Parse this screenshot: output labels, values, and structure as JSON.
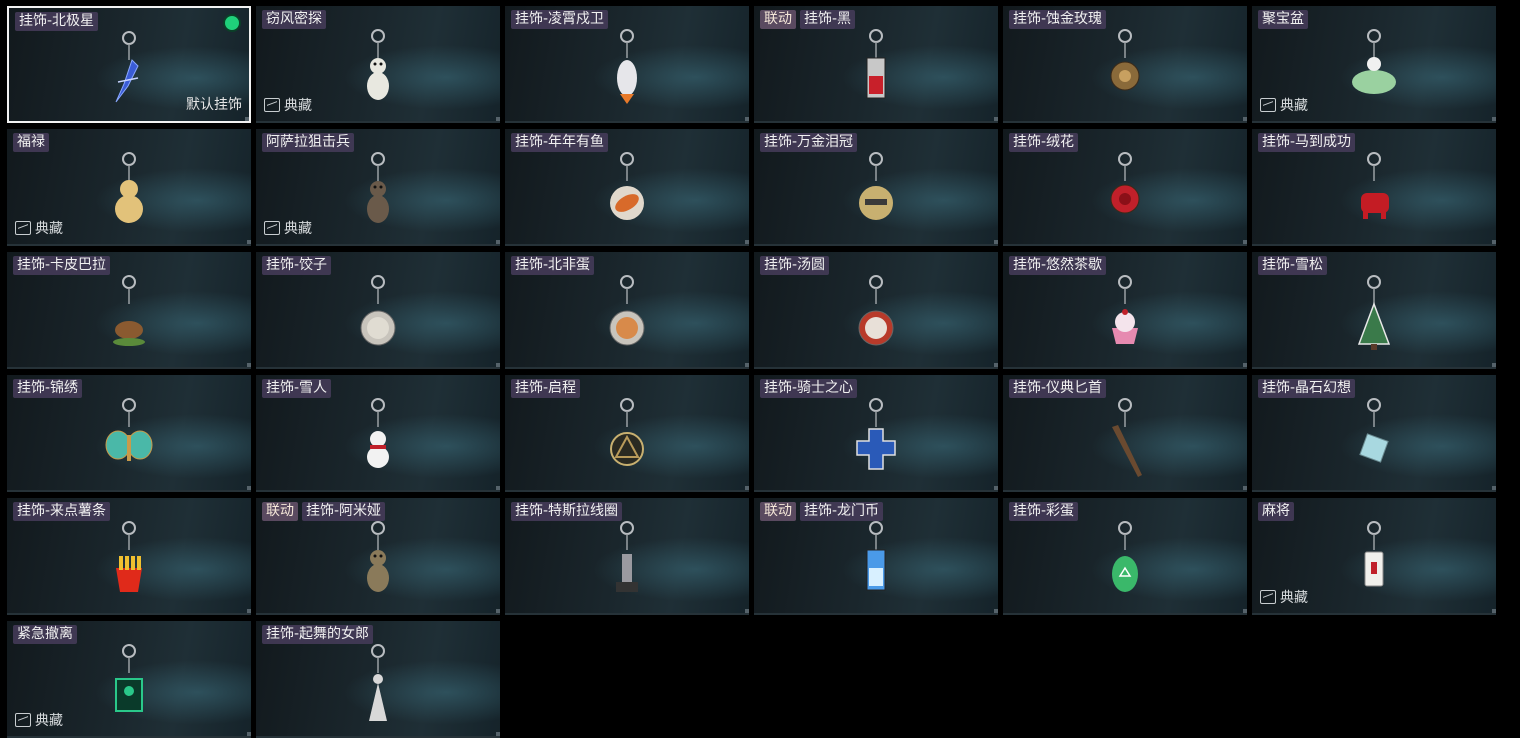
{
  "default_label": "默认挂饰",
  "collection_label": "典藏",
  "items": [
    {
      "labels": [
        "挂饰-北极星"
      ],
      "selected": true,
      "default": true,
      "shape": "star",
      "color": "#3a5cd6"
    },
    {
      "labels": [
        "窃风密探"
      ],
      "collection": true,
      "shape": "figure",
      "color": "#e8e8e0"
    },
    {
      "labels": [
        "挂饰-凌霄戍卫"
      ],
      "shape": "rocket",
      "color": "#e6e6ea"
    },
    {
      "labels": [
        "联动",
        "挂饰-黑"
      ],
      "collab": true,
      "shape": "tag",
      "color": "#c8c8c8"
    },
    {
      "labels": [
        "挂饰-蚀金玫瑰"
      ],
      "shape": "rose-gold",
      "color": "#8a6a3a"
    },
    {
      "labels": [
        "聚宝盆"
      ],
      "collection": true,
      "shape": "bowl",
      "color": "#9ad1a0"
    },
    {
      "labels": [
        "福禄"
      ],
      "collection": true,
      "shape": "gourd",
      "color": "#e2c27a"
    },
    {
      "labels": [
        "阿萨拉狙击兵"
      ],
      "collection": true,
      "shape": "figure",
      "color": "#6a5a4a"
    },
    {
      "labels": [
        "挂饰-年年有鱼"
      ],
      "shape": "fish",
      "color": "#d86a2a"
    },
    {
      "labels": [
        "挂饰-万金泪冠"
      ],
      "shape": "coin",
      "color": "#c8b070"
    },
    {
      "labels": [
        "挂饰-绒花"
      ],
      "shape": "rose",
      "color": "#c0202a"
    },
    {
      "labels": [
        "挂饰-马到成功"
      ],
      "shape": "horse",
      "color": "#c41c24"
    },
    {
      "labels": [
        "挂饰-卡皮巴拉"
      ],
      "shape": "capybara",
      "color": "#8a5a30"
    },
    {
      "labels": [
        "挂饰-饺子"
      ],
      "shape": "plate",
      "color": "#e0dcd2"
    },
    {
      "labels": [
        "挂饰-北非蛋"
      ],
      "shape": "plate",
      "color": "#d88a4a"
    },
    {
      "labels": [
        "挂饰-汤圆"
      ],
      "shape": "bowl-red",
      "color": "#b83a2a"
    },
    {
      "labels": [
        "挂饰-悠然茶歇"
      ],
      "shape": "cake",
      "color": "#e68ab0"
    },
    {
      "labels": [
        "挂饰-雪松"
      ],
      "shape": "tree",
      "color": "#3a7a4a"
    },
    {
      "labels": [
        "挂饰-锦绣"
      ],
      "shape": "butterfly",
      "color": "#4ab8a8"
    },
    {
      "labels": [
        "挂饰-雪人"
      ],
      "shape": "snowman",
      "color": "#f2f2f2"
    },
    {
      "labels": [
        "挂饰-启程"
      ],
      "shape": "medal",
      "color": "#b89a5a"
    },
    {
      "labels": [
        "挂饰-骑士之心"
      ],
      "shape": "cross",
      "color": "#2a5ab8"
    },
    {
      "labels": [
        "挂饰-仪典匕首"
      ],
      "shape": "dagger",
      "color": "#6a4a30"
    },
    {
      "labels": [
        "挂饰-晶石幻想"
      ],
      "shape": "cube",
      "color": "#a8d8e0"
    },
    {
      "labels": [
        "挂饰-来点薯条"
      ],
      "shape": "fries",
      "color": "#e02a1a"
    },
    {
      "labels": [
        "联动",
        "挂饰-阿米娅"
      ],
      "collab": true,
      "shape": "figure",
      "color": "#8a7a5a"
    },
    {
      "labels": [
        "挂饰-特斯拉线圈"
      ],
      "shape": "tower",
      "color": "#9a9aa0"
    },
    {
      "labels": [
        "联动",
        "挂饰-龙门币"
      ],
      "collab": true,
      "shape": "card",
      "color": "#4a9ae8"
    },
    {
      "labels": [
        "挂饰-彩蛋"
      ],
      "shape": "egg",
      "color": "#3ab86a"
    },
    {
      "labels": [
        "麻将"
      ],
      "collection": true,
      "shape": "mahjong",
      "color": "#f0f0ec"
    },
    {
      "labels": [
        "紧急撤离"
      ],
      "collection": true,
      "shape": "sign",
      "color": "#2ac88a"
    },
    {
      "labels": [
        "挂饰-起舞的女郎"
      ],
      "shape": "dancer",
      "color": "#d8d8d8"
    }
  ]
}
